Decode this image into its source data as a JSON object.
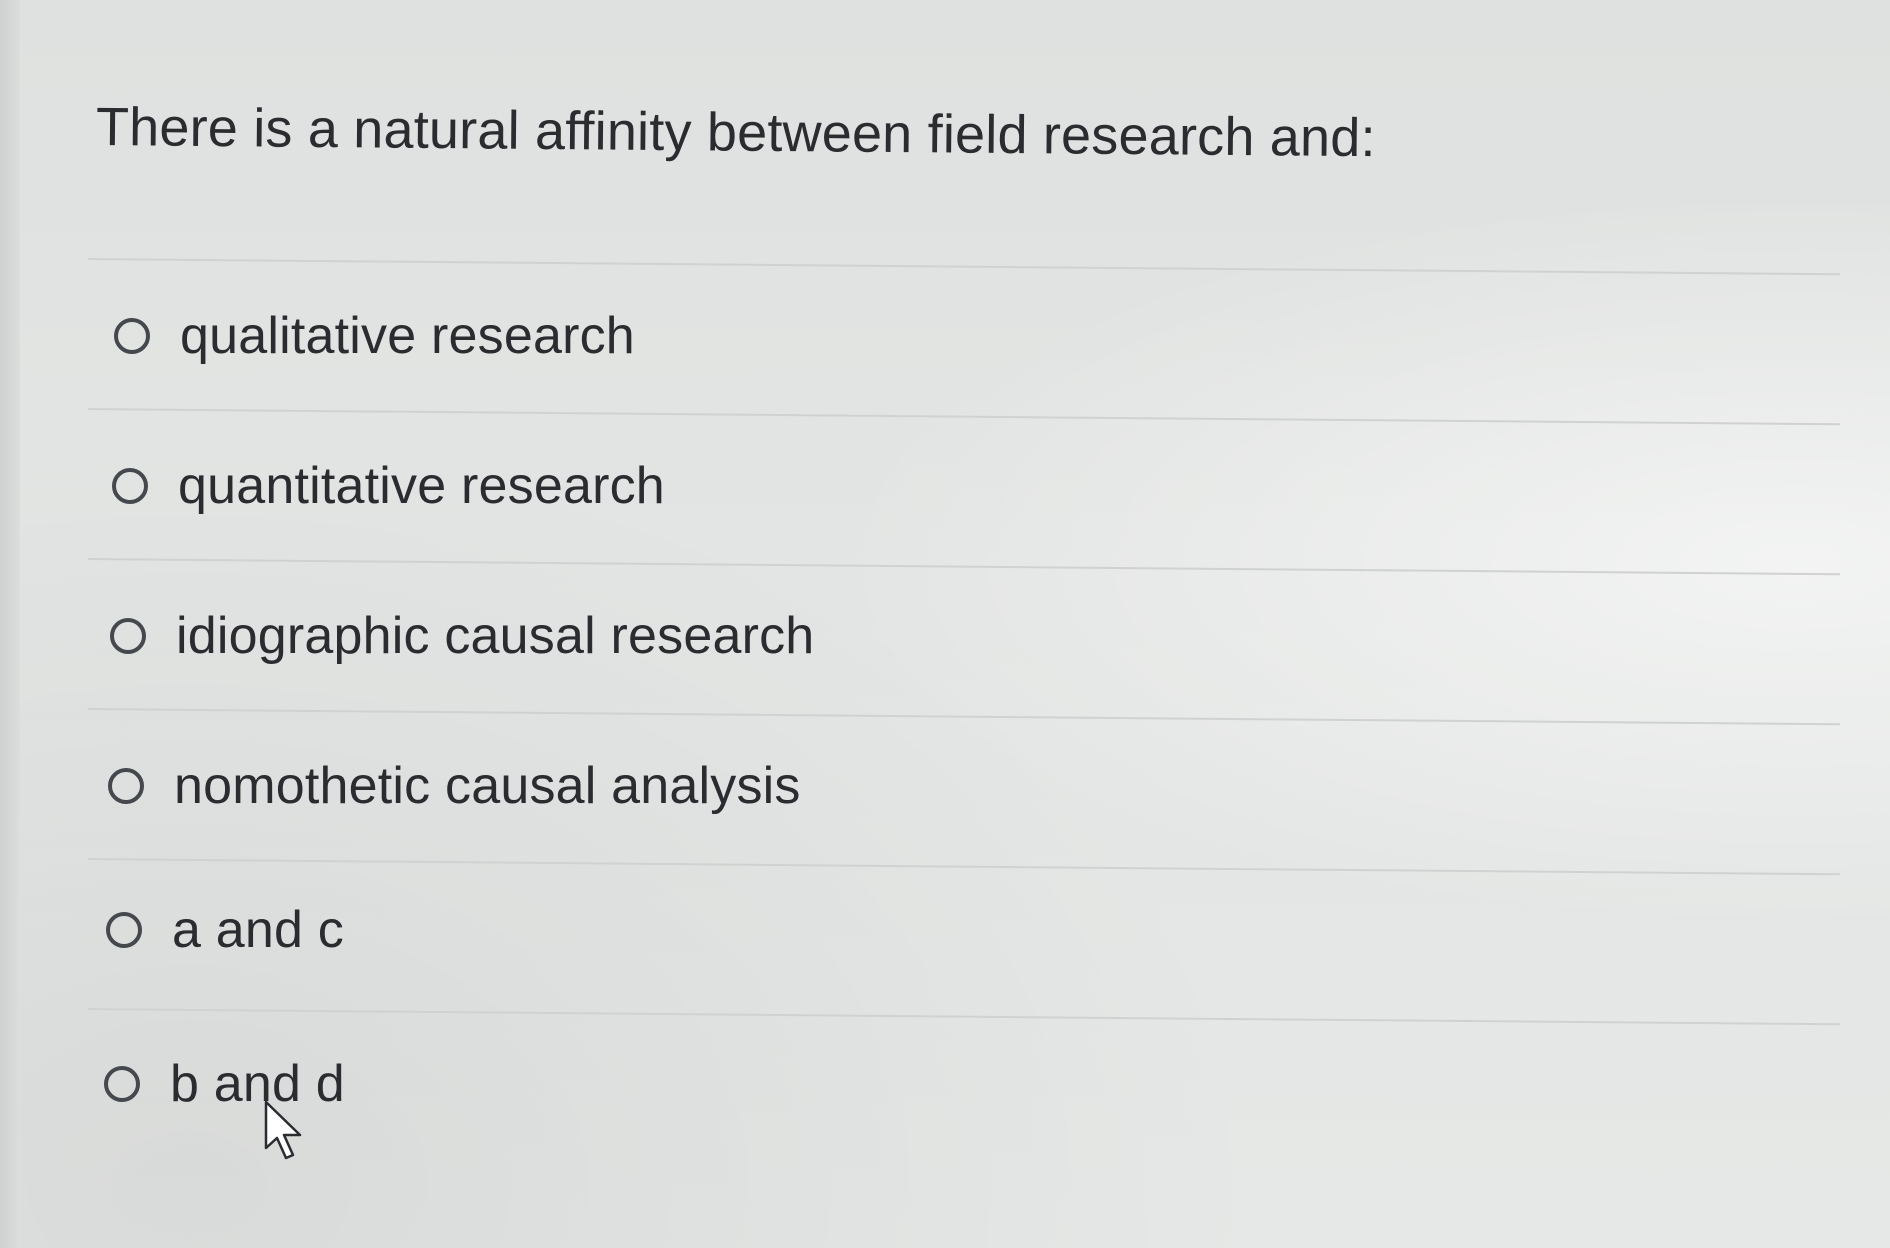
{
  "question": {
    "text": "There is a natural affinity between field research and:"
  },
  "options": [
    {
      "label": "qualitative research",
      "selected": false
    },
    {
      "label": "quantitative research",
      "selected": false
    },
    {
      "label": "idiographic causal research",
      "selected": false
    },
    {
      "label": "nomothetic causal analysis",
      "selected": false
    },
    {
      "label": "a and c",
      "selected": false
    },
    {
      "label": "b and d",
      "selected": false
    }
  ],
  "icons": {
    "radio": "radio-unchecked-icon",
    "cursor": "arrow-pointer-icon"
  },
  "colors": {
    "background": "#e4e6e5",
    "text": "#2a2c30",
    "divider": "#cfd2d1",
    "radio_border": "#45484c"
  }
}
